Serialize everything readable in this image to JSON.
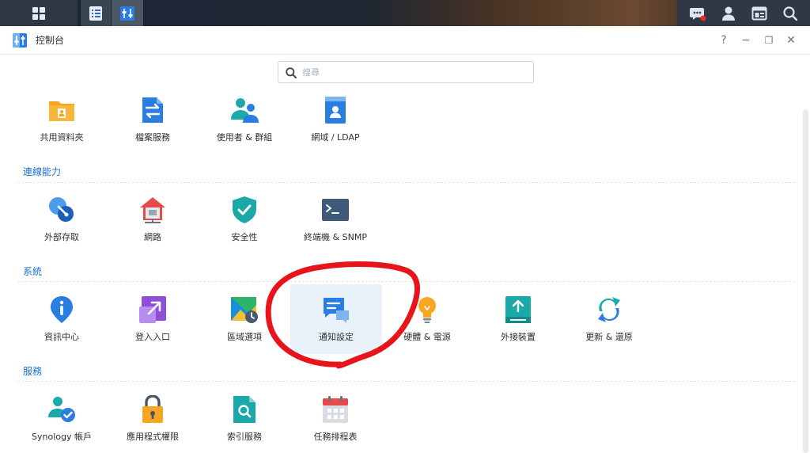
{
  "window": {
    "title": "控制台"
  },
  "window_controls": [
    "?",
    "−",
    "❐",
    "✕"
  ],
  "search": {
    "placeholder": "搜尋"
  },
  "sections": [
    {
      "title": "",
      "items": [
        "共用資料夾",
        "檔案服務",
        "使用者 & 群組",
        "網域 / LDAP"
      ]
    },
    {
      "title": "連線能力",
      "items": [
        "外部存取",
        "網路",
        "安全性",
        "終端機 & SNMP"
      ]
    },
    {
      "title": "系統",
      "items": [
        "資訊中心",
        "登入入口",
        "區域選項",
        "通知設定",
        "硬體 & 電源",
        "外接裝置",
        "更新 & 還原"
      ]
    },
    {
      "title": "服務",
      "items": [
        "Synology 帳戶",
        "應用程式權限",
        "索引服務",
        "任務排程表"
      ]
    }
  ],
  "selected_item": "通知設定",
  "colors": {
    "accent": "#1b6fd1",
    "annotation": "#e8141b",
    "selected_bg": "#e9f2fb"
  }
}
